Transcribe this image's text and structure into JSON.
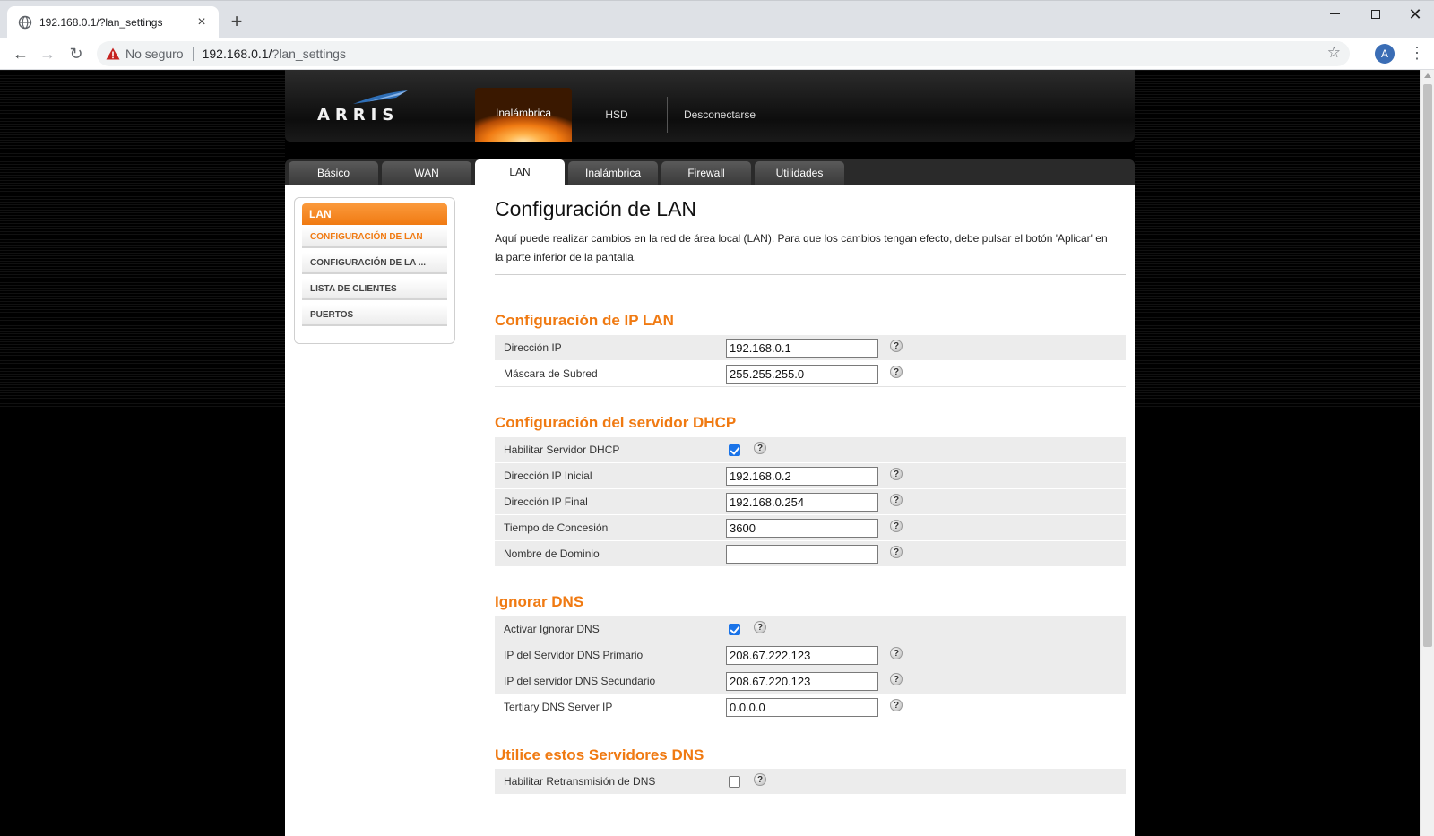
{
  "browser": {
    "tab_title": "192.168.0.1/?lan_settings",
    "not_secure_label": "No seguro",
    "url_host": "192.168.0.1/",
    "url_path": "?lan_settings",
    "avatar_initial": "A"
  },
  "header": {
    "logo_text": "ARRIS",
    "nav": {
      "wireless": "Inalámbrica",
      "hsd": "HSD",
      "logout": "Desconectarse"
    }
  },
  "subtabs": [
    "Básico",
    "WAN",
    "LAN",
    "Inalámbrica",
    "Firewall",
    "Utilidades"
  ],
  "sidebar": {
    "title": "LAN",
    "items": [
      "CONFIGURACIÓN DE LAN",
      "CONFIGURACIÓN DE LA ...",
      "LISTA DE CLIENTES",
      "PUERTOS"
    ]
  },
  "main": {
    "title": "Configuración de LAN",
    "description": "Aquí puede realizar cambios en la red de área local (LAN). Para que los cambios tengan efecto, debe pulsar el botón 'Aplicar' en la parte inferior de la pantalla.",
    "help_glyph": "?",
    "ip_section": {
      "title": "Configuración de IP LAN",
      "ip_label": "Dirección IP",
      "ip_value": "192.168.0.1",
      "mask_label": "Máscara de Subred",
      "mask_value": "255.255.255.0"
    },
    "dhcp_section": {
      "title": "Configuración del servidor DHCP",
      "enable_label": "Habilitar Servidor DHCP",
      "enable_checked": true,
      "start_label": "Dirección IP Inicial",
      "start_value": "192.168.0.2",
      "end_label": "Dirección IP Final",
      "end_value": "192.168.0.254",
      "lease_label": "Tiempo de Concesión",
      "lease_value": "3600",
      "domain_label": "Nombre de Dominio",
      "domain_value": ""
    },
    "dns_override": {
      "title": "Ignorar DNS",
      "enable_label": "Activar Ignorar DNS",
      "enable_checked": true,
      "primary_label": "IP del Servidor DNS Primario",
      "primary_value": "208.67.222.123",
      "secondary_label": "IP del servidor DNS Secundario",
      "secondary_value": "208.67.220.123",
      "tertiary_label": "Tertiary DNS Server IP",
      "tertiary_value": "0.0.0.0"
    },
    "dns_relay": {
      "title": "Utilice estos Servidores DNS",
      "enable_label": "Habilitar Retransmisión de DNS",
      "enable_checked": false
    }
  },
  "colors": {
    "accent": "#f07a12",
    "checkbox": "#1a73e8"
  }
}
